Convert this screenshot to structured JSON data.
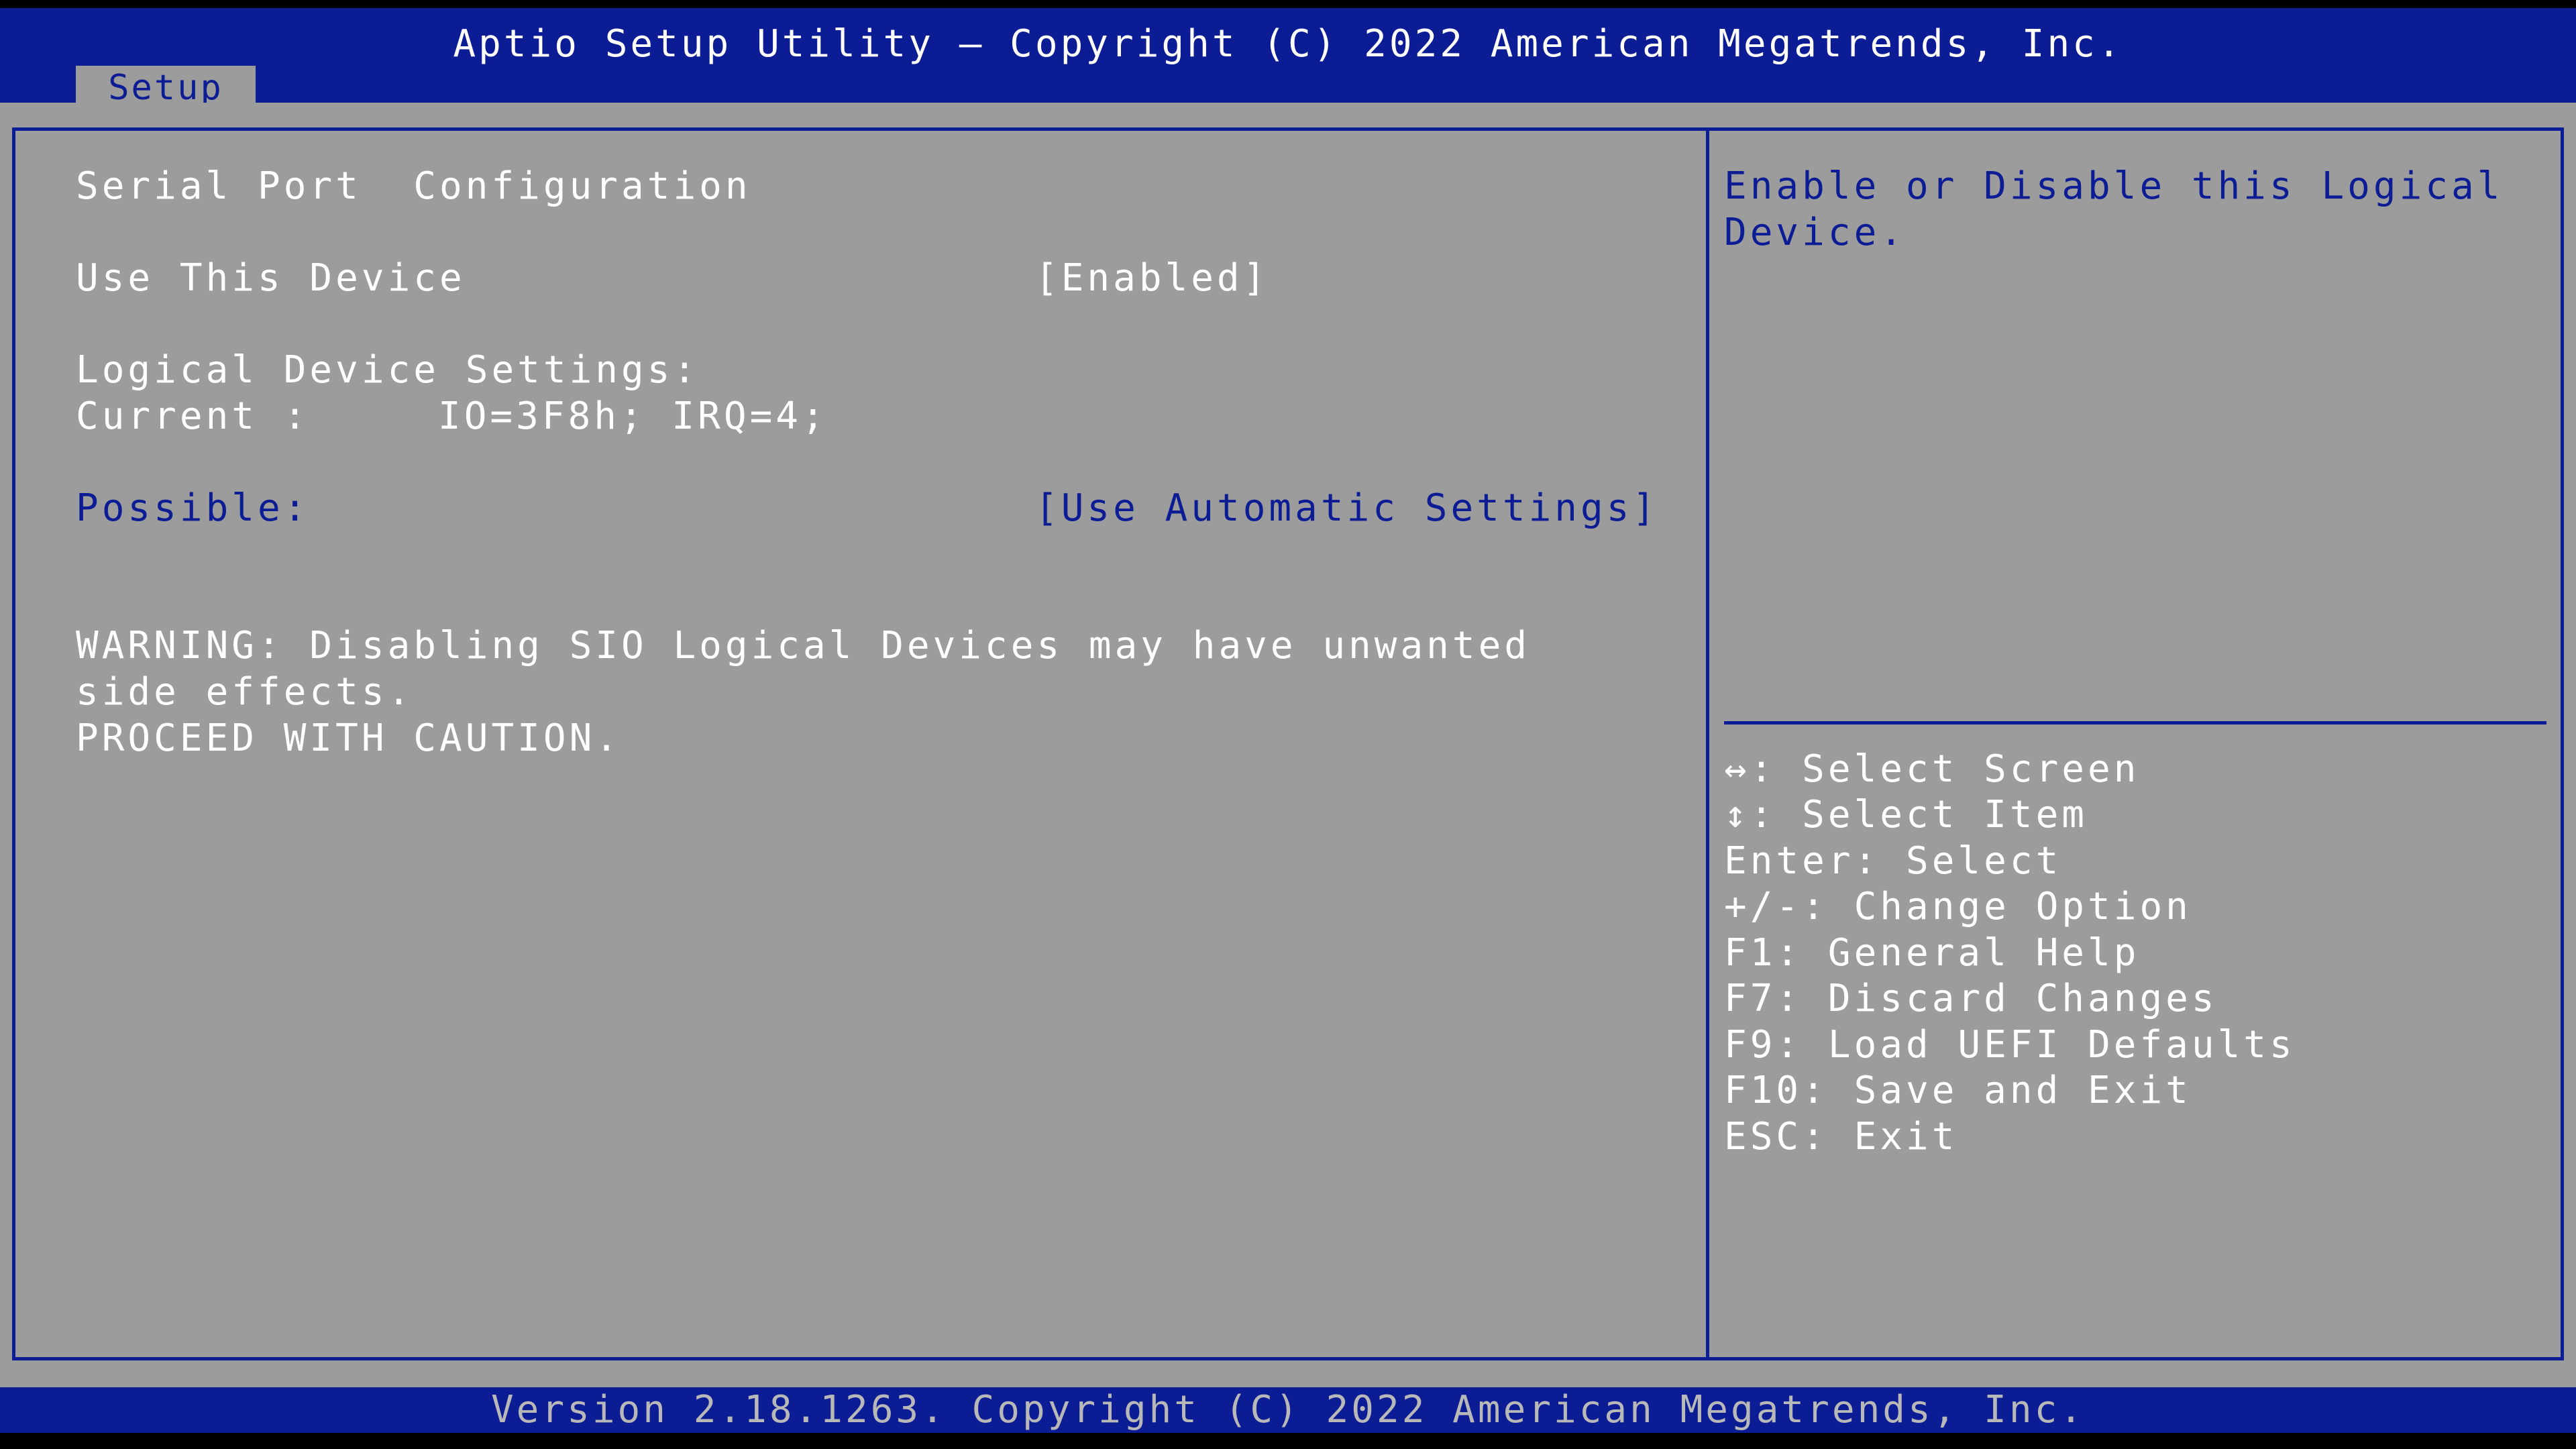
{
  "header": {
    "title": "Aptio Setup Utility – Copyright (C) 2022 American Megatrends, Inc.",
    "tabs": [
      {
        "label": "Setup"
      }
    ]
  },
  "main": {
    "page_title": "Serial Port  Configuration",
    "use_device": {
      "label": "Use This Device",
      "value": "[Enabled]"
    },
    "logical_settings_label": "Logical Device Settings:",
    "current": {
      "label": "Current :",
      "value": "IO=3F8h; IRQ=4;"
    },
    "possible": {
      "label": "Possible:",
      "value": "[Use Automatic Settings]"
    },
    "warning_lines": [
      "WARNING: Disabling SIO Logical Devices may have unwanted",
      "side effects.",
      "PROCEED WITH CAUTION."
    ]
  },
  "help": {
    "description_lines": [
      "Enable or Disable this Logical",
      "Device."
    ],
    "keys": [
      "↔: Select Screen",
      "↕: Select Item",
      "Enter: Select",
      "+/-: Change Option",
      "F1: General Help",
      "F7: Discard Changes",
      "F9: Load UEFI Defaults",
      "F10: Save and Exit",
      "ESC: Exit"
    ]
  },
  "footer": {
    "version": "Version 2.18.1263. Copyright (C) 2022 American Megatrends, Inc."
  },
  "colors": {
    "bios_blue": "#0c1c94",
    "panel_gray": "#9c9c9c",
    "text_white": "#ffffff"
  }
}
